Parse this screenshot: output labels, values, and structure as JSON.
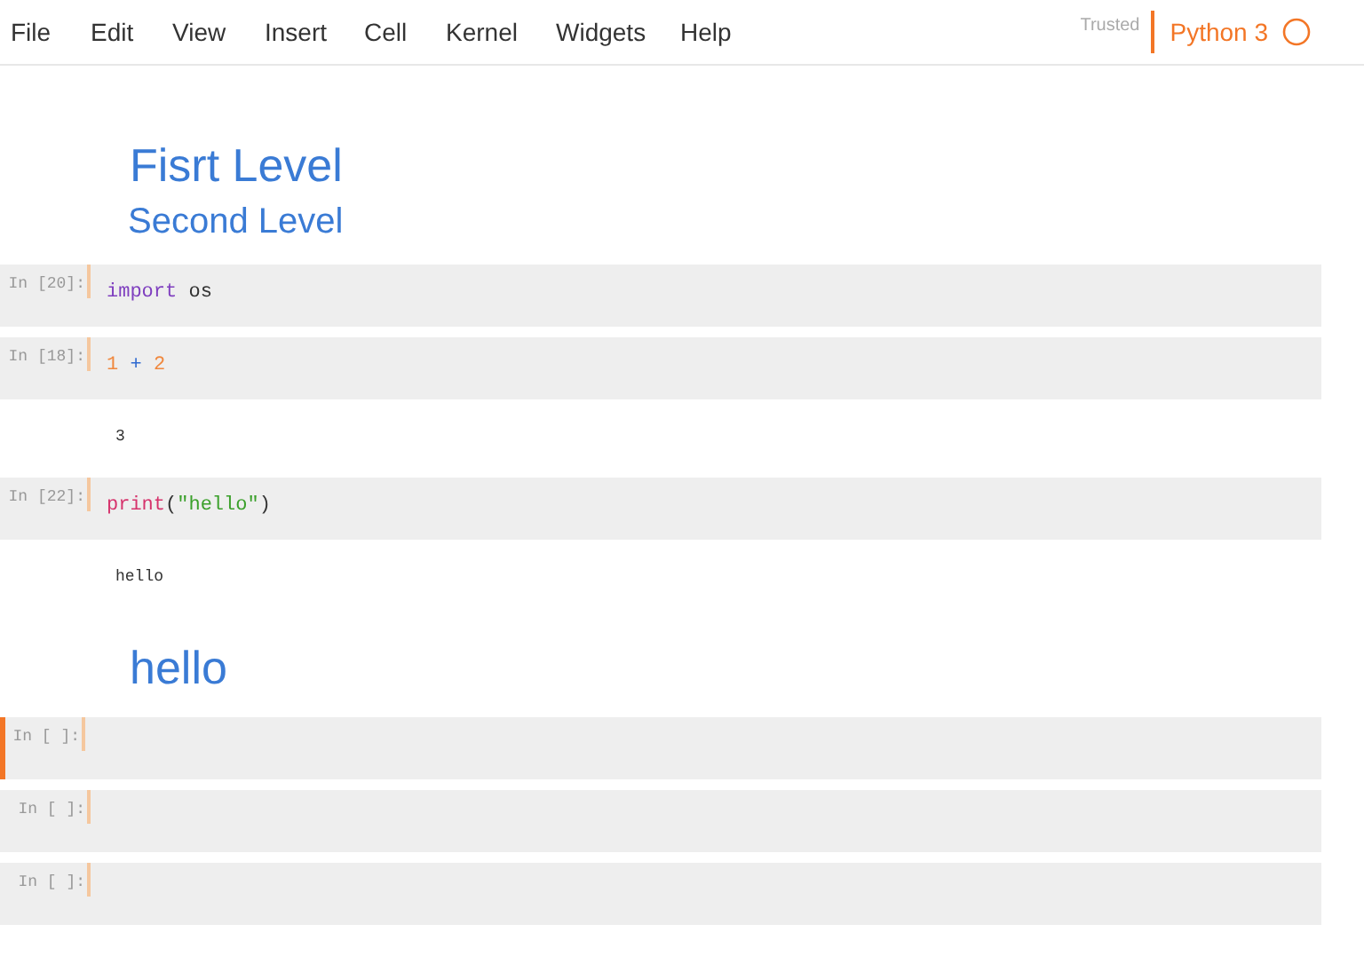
{
  "menu": [
    "File",
    "Edit",
    "View",
    "Insert",
    "Cell",
    "Kernel",
    "Widgets",
    "Help"
  ],
  "trusted": "Trusted",
  "kernel": {
    "name": "Python 3",
    "busy": false
  },
  "cells": [
    {
      "kind": "title",
      "text": "Fisrt Level"
    },
    {
      "kind": "subtitle",
      "text": "Second Level"
    },
    {
      "kind": "code",
      "prompt": "In [20]:",
      "selected": false,
      "tokens": [
        {
          "kind": "keyword",
          "text": "import"
        },
        {
          "kind": "name",
          "text": "os"
        }
      ]
    },
    {
      "kind": "code",
      "prompt": "In [18]:",
      "selected": false,
      "tokens": [
        {
          "kind": "number",
          "text": "1"
        },
        {
          "kind": "operator",
          "text": "+"
        },
        {
          "kind": "number",
          "text": "2"
        }
      ]
    },
    {
      "kind": "output",
      "text": "3"
    },
    {
      "kind": "code",
      "prompt": "In [22]:",
      "selected": false,
      "tokens": [
        {
          "kind": "builtin",
          "text": "print"
        },
        {
          "kind": "punct",
          "text": "("
        },
        {
          "kind": "string",
          "text": "\"hello\""
        },
        {
          "kind": "punct",
          "text": ")"
        }
      ]
    },
    {
      "kind": "output",
      "text": "hello"
    },
    {
      "kind": "title",
      "text": "hello"
    },
    {
      "kind": "code",
      "prompt": "In [ ]:",
      "selected": true
    },
    {
      "kind": "code",
      "prompt": "In [ ]:",
      "selected": false
    },
    {
      "kind": "code",
      "prompt": "In [ ]:",
      "selected": false
    }
  ]
}
